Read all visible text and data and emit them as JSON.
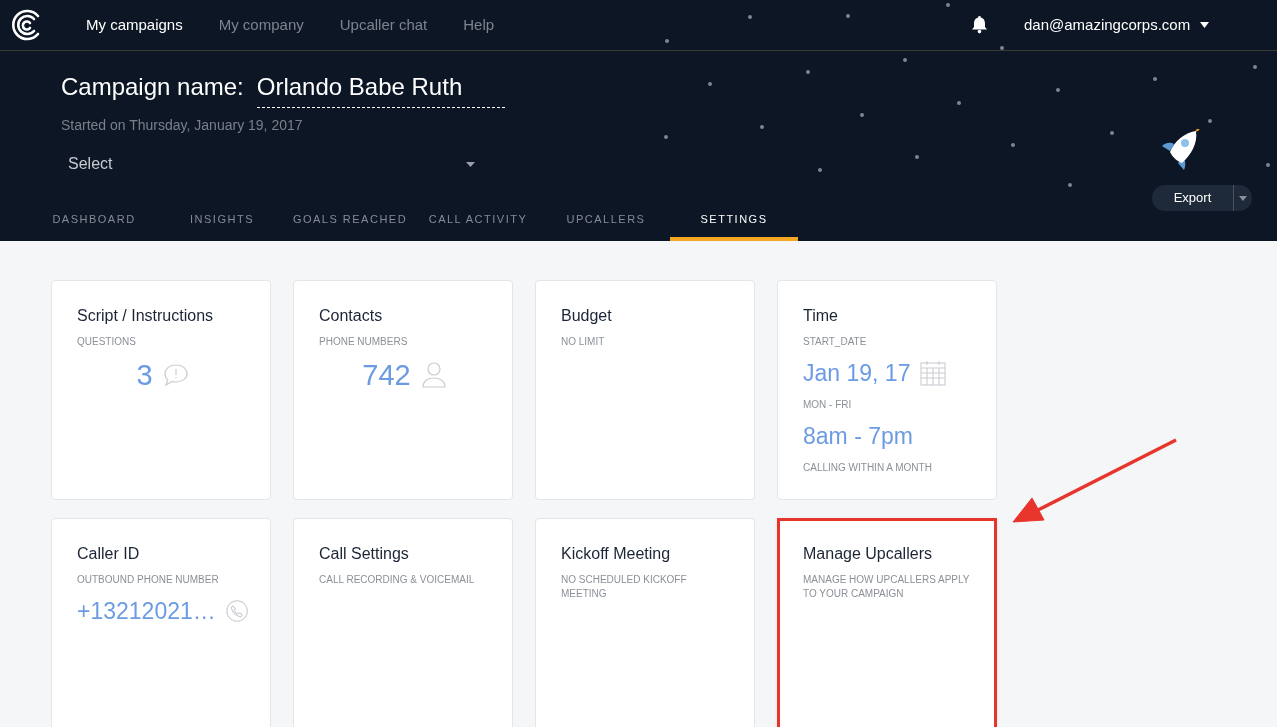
{
  "nav": {
    "links": [
      {
        "label": "My campaigns",
        "selected": true
      },
      {
        "label": "My company",
        "selected": false
      },
      {
        "label": "Upcaller chat",
        "selected": false
      },
      {
        "label": "Help",
        "selected": false
      }
    ],
    "user": "dan@amazingcorps.com"
  },
  "campaign": {
    "label": "Campaign name:",
    "name": "Orlando Babe Ruth",
    "started": "Started on Thursday, January 19, 2017",
    "select": {
      "value": "Select"
    },
    "export_button": "Export"
  },
  "tabs": [
    {
      "label": "DASHBOARD",
      "selected": false
    },
    {
      "label": "INSIGHTS",
      "selected": false
    },
    {
      "label": "GOALS REACHED",
      "selected": false
    },
    {
      "label": "CALL ACTIVITY",
      "selected": false
    },
    {
      "label": "UPCALLERS",
      "selected": false
    },
    {
      "label": "SETTINGS",
      "selected": true
    }
  ],
  "cards": [
    {
      "title": "Script / Instructions",
      "highlighted": false,
      "lines": [
        {
          "kind": "label",
          "text": "QUESTIONS"
        },
        {
          "kind": "count",
          "text": "3"
        }
      ]
    },
    {
      "title": "Contacts",
      "highlighted": false,
      "lines": [
        {
          "kind": "label",
          "text": "PHONE NUMBERS"
        },
        {
          "kind": "count",
          "text": "742"
        }
      ]
    },
    {
      "title": "Budget",
      "highlighted": false,
      "lines": [
        {
          "kind": "label",
          "text": "NO LIMIT"
        }
      ]
    },
    {
      "title": "Time",
      "highlighted": false,
      "lines": [
        {
          "kind": "label",
          "text": "START_DATE"
        },
        {
          "kind": "value",
          "text": "Jan 19, 17"
        },
        {
          "kind": "label",
          "text": "MON - FRI"
        },
        {
          "kind": "value",
          "text": "8am - 7pm"
        },
        {
          "kind": "label",
          "text": "CALLING WITHIN A MONTH"
        }
      ]
    },
    {
      "title": "Caller ID",
      "highlighted": false,
      "lines": [
        {
          "kind": "label",
          "text": "OUTBOUND PHONE NUMBER"
        },
        {
          "kind": "value",
          "text": "+13212021…"
        }
      ]
    },
    {
      "title": "Call Settings",
      "highlighted": false,
      "lines": [
        {
          "kind": "label",
          "text": "CALL RECORDING & VOICEMAIL"
        }
      ]
    },
    {
      "title": "Kickoff Meeting",
      "highlighted": false,
      "lines": [
        {
          "kind": "label",
          "text": "NO SCHEDULED KICKOFF MEETING"
        }
      ]
    },
    {
      "title": "Manage Upcallers",
      "highlighted": true,
      "lines": [
        {
          "kind": "label",
          "text": "MANAGE HOW UPCALLERS APPLY TO YOUR CAMPAIGN"
        }
      ]
    }
  ]
}
